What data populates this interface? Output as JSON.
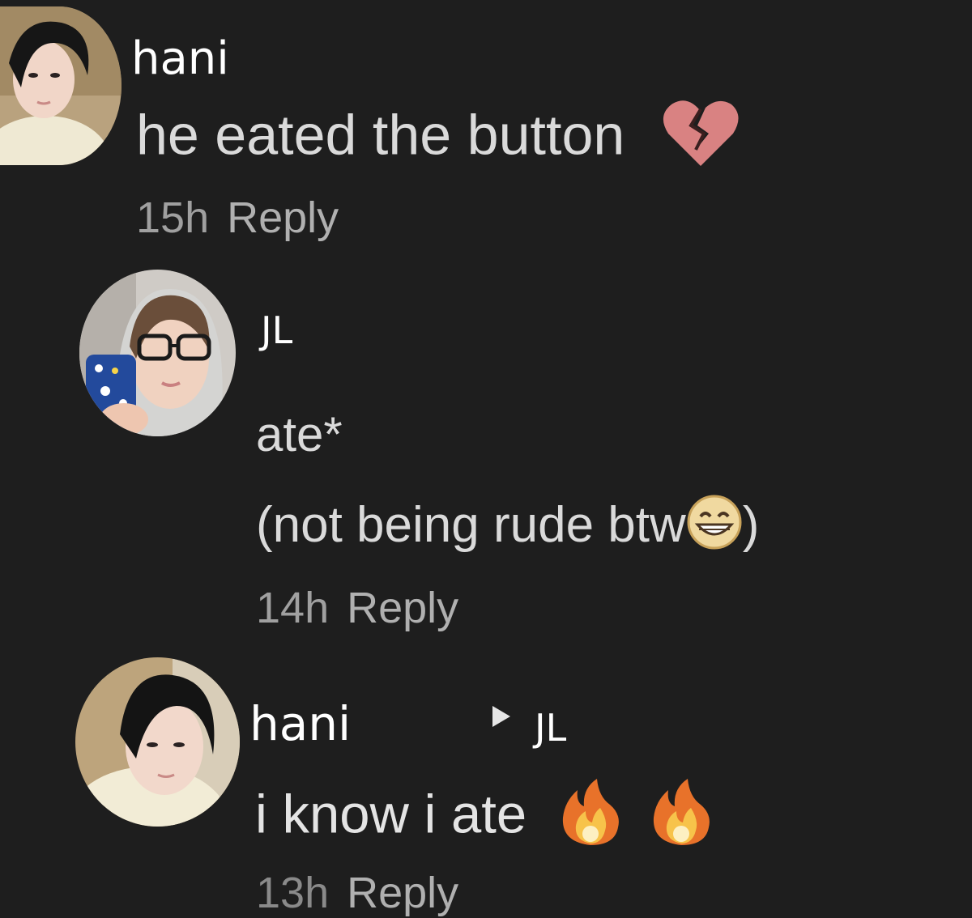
{
  "comments": [
    {
      "username": "hani",
      "text": "he eated the button",
      "emoji": "broken-heart",
      "time": "15h",
      "reply_label": "Reply"
    },
    {
      "username": "JL",
      "text_line1": "ate*",
      "text_line2": "(not being rude btw",
      "text_line2_end": ")",
      "emoji": "grinning-face",
      "time": "14h",
      "reply_label": "Reply"
    },
    {
      "username": "hani",
      "reply_to": "JL",
      "text": "i know i ate",
      "emojis": [
        "fire",
        "fire"
      ],
      "time": "13h",
      "reply_label": "Reply"
    }
  ],
  "colors": {
    "background": "#1e1e1e",
    "username": "#ffffff",
    "comment_text": "#dadada",
    "meta_text": "#a0a0a0"
  }
}
